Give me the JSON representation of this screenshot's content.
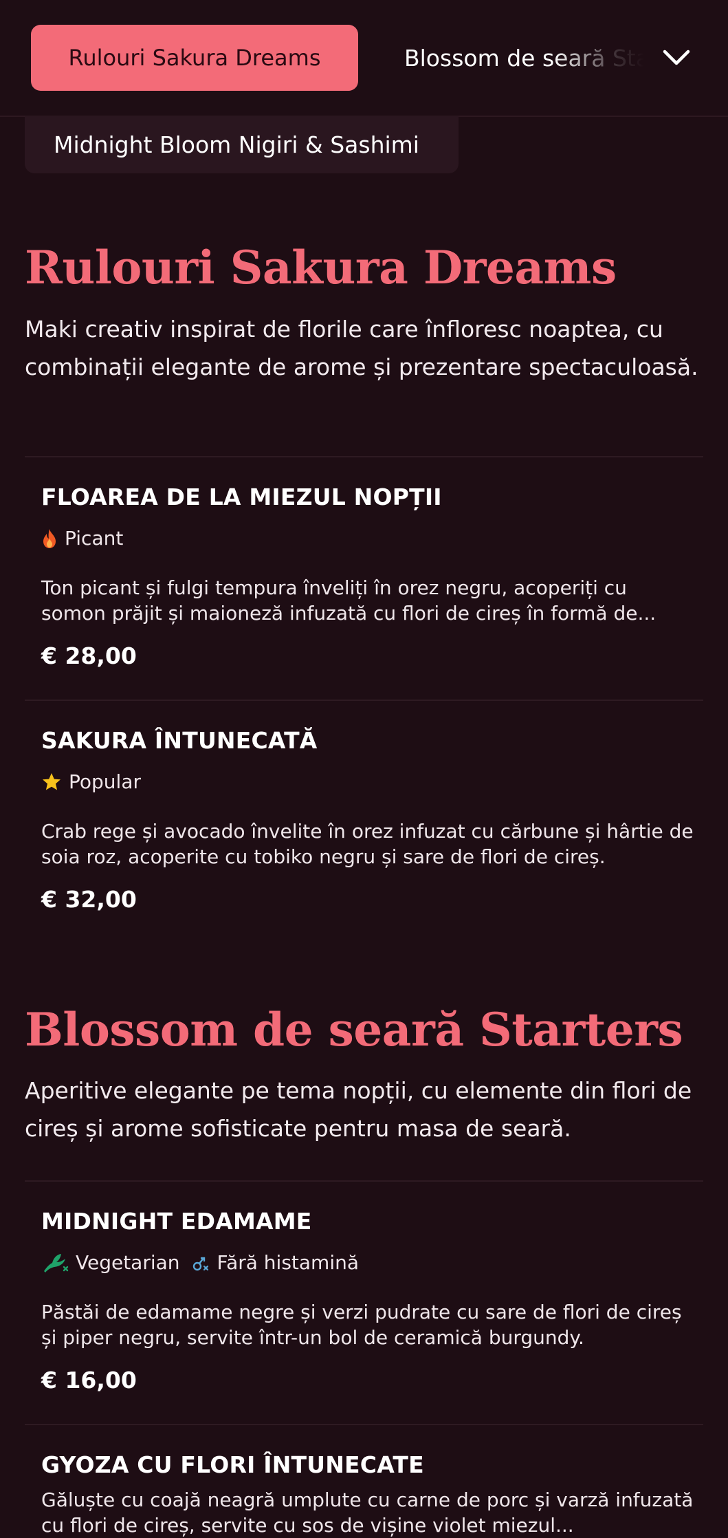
{
  "nav": {
    "active_tab": "Rulouri Sakura Dreams",
    "next_tab": "Blossom de seară Starters",
    "sub_tab": "Midnight Bloom Nigiri & Sashimi",
    "chevron_icon": "chevron-down-icon"
  },
  "colors": {
    "accent": "#f36b78",
    "background": "#1e0d14"
  },
  "sections": [
    {
      "title": "Rulouri Sakura Dreams",
      "description": "Maki creativ inspirat de florile care înfloresc noaptea, cu combinații elegante de arome și prezentare spectaculoasă.",
      "items": [
        {
          "name": "FLOAREA DE LA MIEZUL NOPȚII",
          "tags": [
            {
              "label": "Picant",
              "icon": "flame-icon"
            }
          ],
          "description": "Ton picant și fulgi tempura înveliți în orez negru, acoperiți cu somon prăjit și maioneză infuzată cu flori de cireș în formă de...",
          "price": "€ 28,00"
        },
        {
          "name": "SAKURA ÎNTUNECATĂ",
          "tags": [
            {
              "label": "Popular",
              "icon": "star-icon"
            }
          ],
          "description": "Crab rege și avocado învelite în orez infuzat cu cărbune și hârtie de soia roz, acoperite cu tobiko negru și sare de flori de cireș.",
          "price": "€ 32,00"
        }
      ]
    },
    {
      "title": "Blossom de seară Starters",
      "description": "Aperitive elegante pe tema nopții, cu elemente din flori de cireș și arome sofisticate pentru masa de seară.",
      "items": [
        {
          "name": "MIDNIGHT EDAMAME",
          "tags": [
            {
              "label": "Vegetarian",
              "icon": "vegetarian-icon"
            },
            {
              "label": "Fără histamină",
              "icon": "histamine-free-icon"
            }
          ],
          "description": "Păstăi de edamame negre și verzi pudrate cu sare de flori de cireș și piper negru, servite într-un bol de ceramică burgundy.",
          "price": "€ 16,00"
        },
        {
          "name": "GYOZA CU FLORI ÎNTUNECATE",
          "description": "Găluște cu coajă neagră umplute cu carne de porc și varză infuzată cu flori de cireș, servite cu sos de vișine violet miezul..."
        }
      ]
    }
  ]
}
